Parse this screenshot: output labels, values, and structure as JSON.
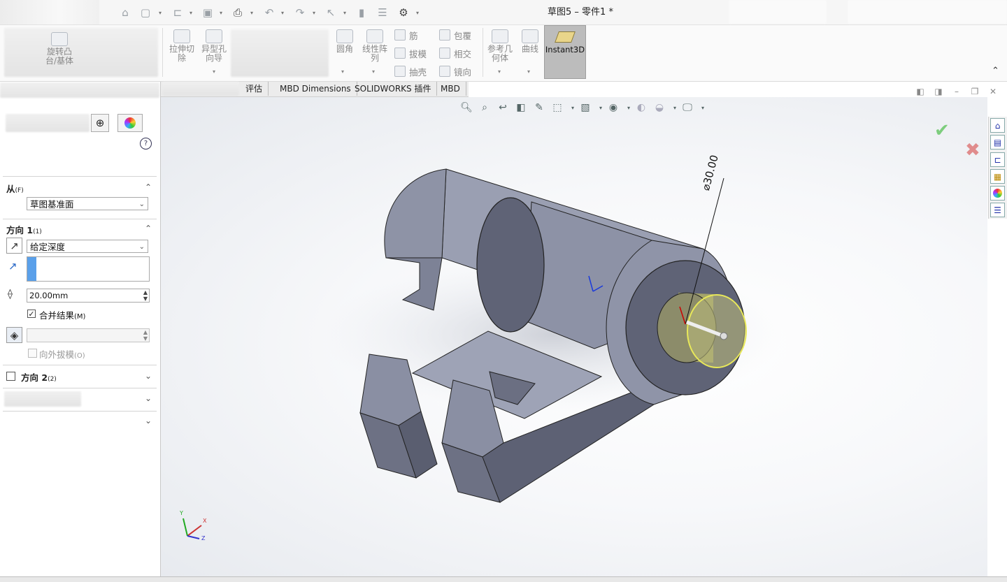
{
  "window": {
    "title": "草图5 – 零件1 *"
  },
  "quick_access": {
    "icons": [
      "home-icon",
      "new-file-icon",
      "open-folder-icon",
      "save-icon",
      "print-icon",
      "undo-icon",
      "redo-icon",
      "select-icon",
      "rebuild-icon",
      "file-properties-icon",
      "options-gear-icon"
    ]
  },
  "ribbon": {
    "left_item": "旋转凸台/基体",
    "extrude_cut": "拉伸切除",
    "hole_wizard": "异型孔向导",
    "fillet": "圆角",
    "linear_pattern": "线性阵列",
    "rib": "筋",
    "draft": "拔模",
    "shell": "抽壳",
    "wrap": "包覆",
    "intersect": "相交",
    "mirror": "镜向",
    "ref_geometry": "参考几何体",
    "curves": "曲线",
    "instant3d": "Instant3D"
  },
  "tabs": {
    "items": [
      "评估",
      "MBD Dimensions",
      "SOLIDWORKS 插件",
      "MBD"
    ]
  },
  "panel": {
    "help": "?",
    "from_section": {
      "title": "从",
      "shortcut": "(F)",
      "value": "草图基准面"
    },
    "direction1": {
      "title": "方向 1",
      "shortcut": "(1)",
      "end_condition": "给定深度",
      "depth": "20.00mm",
      "merge_label": "合并结果",
      "merge_shortcut": "(M)",
      "merge_checked": true,
      "draft_outward_label": "向外拔模",
      "draft_outward_shortcut": "(O)"
    },
    "direction2": {
      "title": "方向 2",
      "shortcut": "(2)",
      "checked": false
    }
  },
  "model": {
    "dimension_label": "⌀30.00"
  },
  "triad": {
    "x": "X",
    "y": "Y",
    "z": "Z"
  },
  "colors": {
    "part_face_light": "#9ea4b8",
    "part_face_mid": "#8a8fa3",
    "part_face_dark": "#5e6274",
    "selected_sketch": "#e8e85a",
    "confirm_green": "#7dcd7d",
    "cancel_red": "#e08c8c",
    "instant3d_bg": "#bcbcbc"
  }
}
